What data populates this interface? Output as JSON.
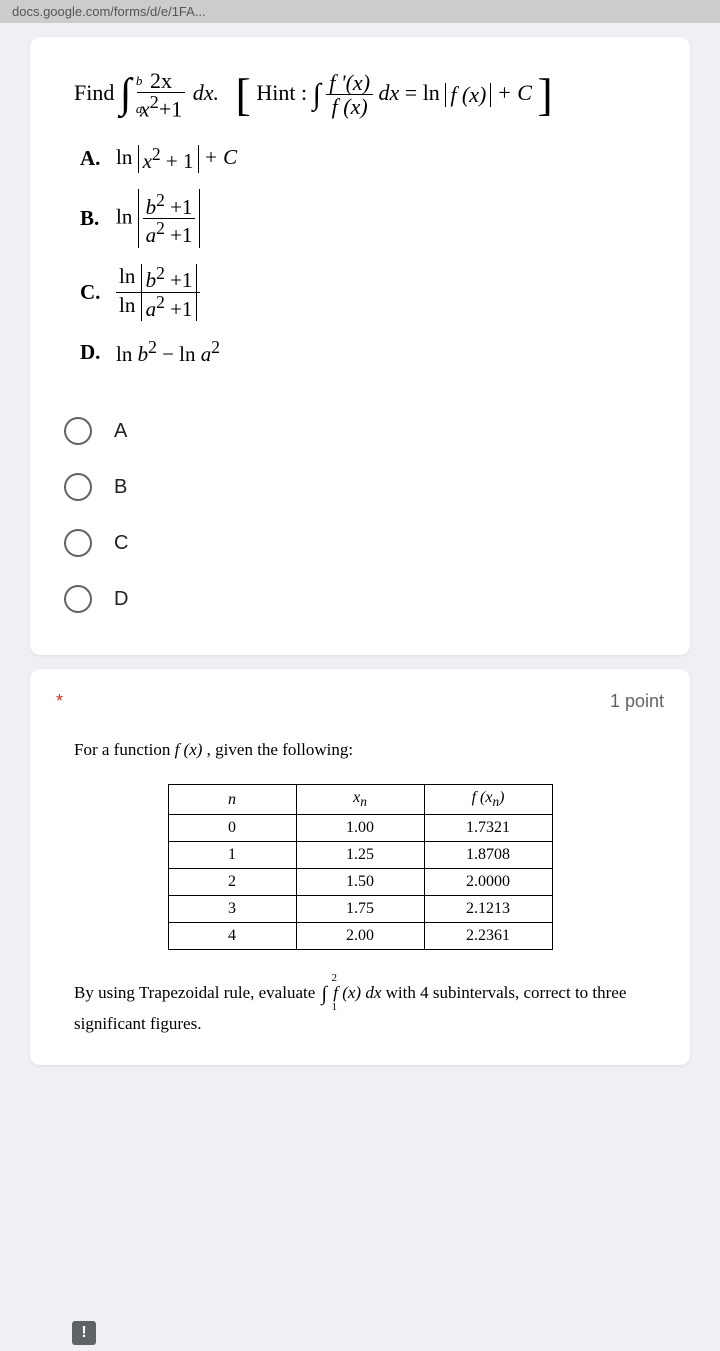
{
  "urlbar": "docs.google.com/forms/d/e/1FA...",
  "q1": {
    "stem_find": "Find",
    "stem_hint": "Hint :",
    "int_upper": "b",
    "int_lower": "a",
    "integrand_num": "2x",
    "integrand_den_a": "x",
    "integrand_den_exp": "2",
    "integrand_den_b": "+1",
    "dx": "dx.",
    "hint_num": "f '(x)",
    "hint_den": "f (x)",
    "hint_dx": "dx",
    "hint_eq": "= ln",
    "hint_fx": "f (x)",
    "hint_C": "+ C",
    "optA_letter": "A.",
    "optA_ln": "ln",
    "optA_in1": "x",
    "optA_exp": "2",
    "optA_in2": " + 1",
    "optA_C": "+ C",
    "optB_letter": "B.",
    "optB_ln": "ln",
    "optB_num_a": "b",
    "optB_num_exp": "2",
    "optB_num_b": " +1",
    "optB_den_a": "a",
    "optB_den_exp": "2",
    "optB_den_b": " +1",
    "optC_letter": "C.",
    "optC_num_ln": "ln",
    "optC_num_a": "b",
    "optC_num_exp": "2",
    "optC_num_b": " +1",
    "optC_den_ln": "ln",
    "optC_den_a": "a",
    "optC_den_exp": "2",
    "optC_den_b": " +1",
    "optD_letter": "D.",
    "optD_t1_ln": "ln ",
    "optD_t1_v": "b",
    "optD_t1_exp": "2",
    "optD_minus": " − ln ",
    "optD_t2_v": "a",
    "optD_t2_exp": "2",
    "radios": [
      "A",
      "B",
      "C",
      "D"
    ]
  },
  "q2": {
    "required": "*",
    "points": "1 point",
    "intro_a": "For a function  ",
    "intro_fn": "f (x)",
    "intro_b": " , given the following:",
    "headers": {
      "n": "n",
      "x": "x",
      "x_sub": "n",
      "f": "f (x",
      "f_sub": "n",
      "f_close": ")"
    },
    "rows": [
      {
        "n": "0",
        "x": "1.00",
        "f": "1.7321"
      },
      {
        "n": "1",
        "x": "1.25",
        "f": "1.8708"
      },
      {
        "n": "2",
        "x": "1.50",
        "f": "2.0000"
      },
      {
        "n": "3",
        "x": "1.75",
        "f": "2.1213"
      },
      {
        "n": "4",
        "x": "2.00",
        "f": "2.2361"
      }
    ],
    "post_a": "By using Trapezoidal rule, evaluate ",
    "int_upper": "2",
    "int_lower": "1",
    "post_fn": "f (x)",
    "post_dx": " dx",
    "post_b": " with 4 subintervals, correct to three",
    "post_c": "significant figures."
  },
  "alert": "!"
}
